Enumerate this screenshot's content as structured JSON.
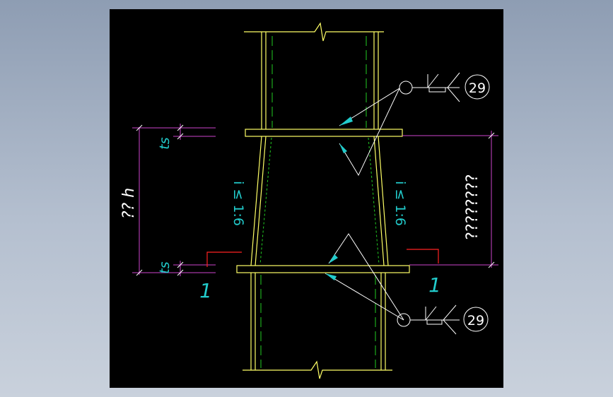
{
  "colors": {
    "background": "#000000",
    "column": "#ffff66",
    "centerline": "#22cc22",
    "leader": "#ffffff",
    "dimension": "#cc44cc",
    "cyan_text": "#22cccc",
    "red_section": "#ff2222"
  },
  "labels": {
    "weld_no_top": "29",
    "weld_no_bottom": "29",
    "thickness_top": "ts",
    "thickness_bottom": "ts",
    "height_left": "?? h",
    "height_right": "????????",
    "slope_left": "i ≤ 1:6",
    "slope_right": "i ≤ 1:6",
    "section_left": "1",
    "section_right": "1"
  }
}
